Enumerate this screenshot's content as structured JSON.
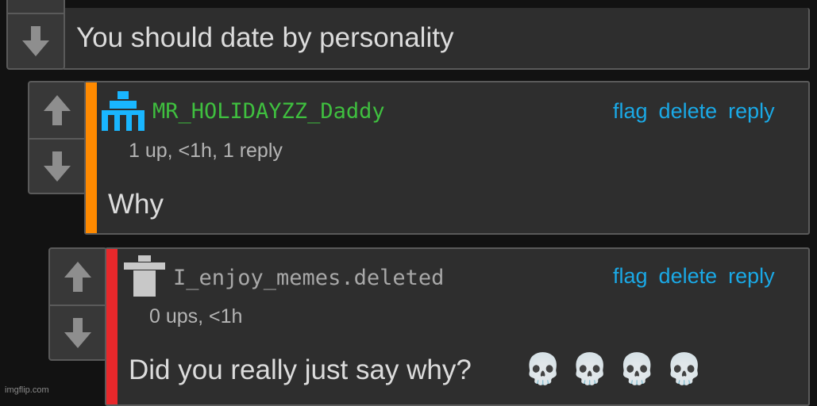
{
  "parent_comment": {
    "text": "You should date by personality"
  },
  "comments": [
    {
      "username": "MR_HOLIDAYZZ_Daddy",
      "username_color": "#3fbf3f",
      "meta": "1 up, <1h, 1 reply",
      "body": "Why",
      "bar_color": "#ff8a00",
      "avatar_icon": "pixel-avatar-icon"
    },
    {
      "username": "I_enjoy_memes.deleted",
      "username_color": "#a8a8a8",
      "meta": "0 ups, <1h",
      "body": "Did you really just say why?",
      "body_emoji": "💀💀💀💀",
      "bar_color": "#e8282b",
      "avatar_icon": "deleted-user-icon"
    }
  ],
  "actions": {
    "flag": "flag",
    "delete": "delete",
    "reply": "reply"
  },
  "watermark": "imgflip.com"
}
